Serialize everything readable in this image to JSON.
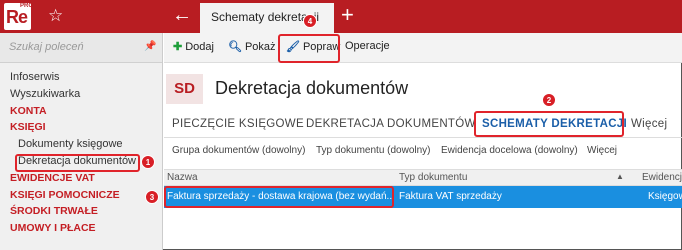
{
  "app": {
    "logo_text": "Re",
    "logo_sup": "PRO",
    "active_tab": "Schematy dekretacji"
  },
  "sidebar": {
    "search_placeholder": "Szukaj poleceń",
    "items": [
      {
        "label": "Infoserwis",
        "kind": "link"
      },
      {
        "label": "Wyszukiwarka",
        "kind": "link"
      },
      {
        "label": "KONTA",
        "kind": "category"
      },
      {
        "label": "KSIĘGI",
        "kind": "category"
      },
      {
        "label": "Dokumenty księgowe",
        "kind": "sub"
      },
      {
        "label": "Dekretacja dokumentów",
        "kind": "sub"
      },
      {
        "label": "EWIDENCJE VAT",
        "kind": "category"
      },
      {
        "label": "KSIĘGI POMOCNICZE",
        "kind": "category"
      },
      {
        "label": "ŚRODKI TRWAŁE",
        "kind": "category"
      },
      {
        "label": "UMOWY I PŁACE",
        "kind": "category"
      }
    ]
  },
  "toolbar": {
    "add": "Dodaj",
    "show": "Pokaż",
    "edit": "Popraw",
    "ops": "Operacje"
  },
  "page": {
    "badge": "SD",
    "title": "Dekretacja dokumentów"
  },
  "tabs": {
    "t1": "PIECZĘCIE KSIĘGOWE",
    "t2": "DEKRETACJA DOKUMENTÓW",
    "t3": "SCHEMATY DEKRETACJI",
    "more": "Więcej"
  },
  "filters": {
    "f1": "Grupa dokumentów (dowolny)",
    "f2": "Typ dokumentu (dowolny)",
    "f3": "Ewidencja docelowa (dowolny)",
    "more": "Więcej"
  },
  "grid": {
    "columns": {
      "c1": "Nazwa",
      "c2": "Typ dokumentu",
      "c3": "Ewidencj"
    },
    "rows": [
      {
        "name": "Faktura sprzedaży - dostawa krajowa (bez wydań...",
        "type": "Faktura VAT sprzedaży",
        "ledger": "Księgow"
      }
    ]
  },
  "callouts": {
    "n1": "1",
    "n2": "2",
    "n3": "3",
    "n4": "4"
  },
  "colors": {
    "brand": "#b81d22",
    "accent": "#1a5ea8",
    "selection": "#1a8fe0",
    "callout": "#e0242b"
  }
}
